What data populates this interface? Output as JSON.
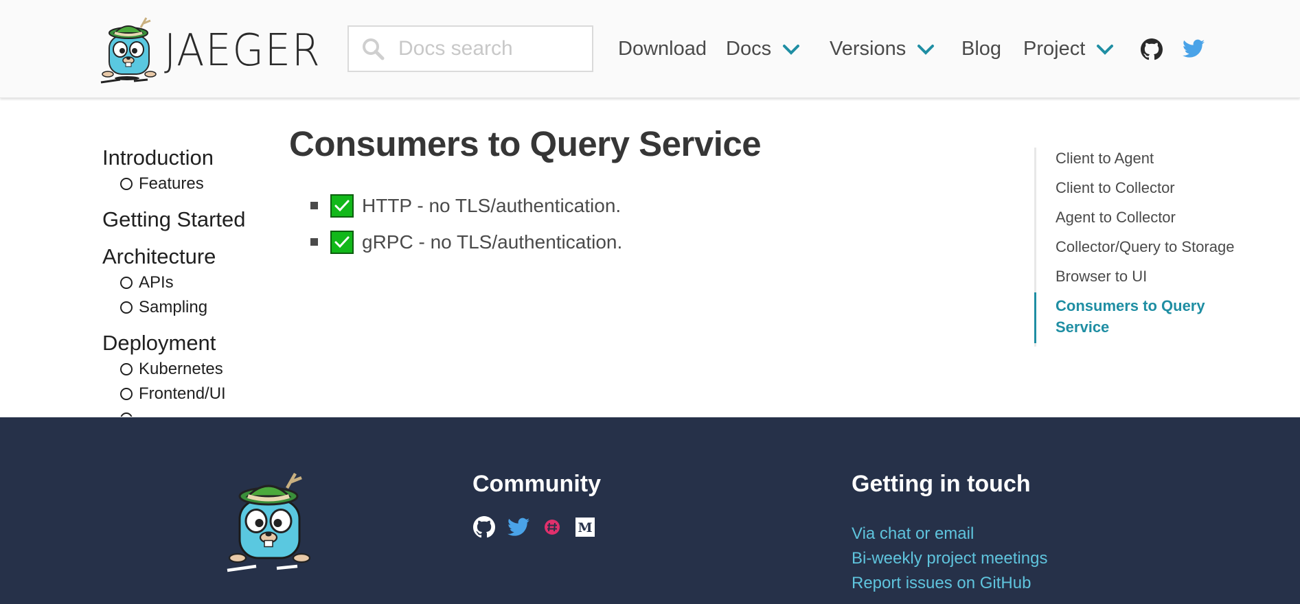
{
  "header": {
    "brand": "JAEGER",
    "search": {
      "placeholder": "Docs search"
    },
    "nav": [
      {
        "label": "Download",
        "dropdown": false
      },
      {
        "label": "Docs",
        "dropdown": true
      },
      {
        "label": "Versions",
        "dropdown": true
      },
      {
        "label": "Blog",
        "dropdown": false
      },
      {
        "label": "Project",
        "dropdown": true
      }
    ],
    "icons": [
      "github-icon",
      "twitter-icon"
    ]
  },
  "sidebar": {
    "sections": [
      {
        "title": "Introduction",
        "items": [
          "Features"
        ]
      },
      {
        "title": "Getting Started",
        "items": []
      },
      {
        "title": "Architecture",
        "items": [
          "APIs",
          "Sampling"
        ]
      },
      {
        "title": "Deployment",
        "items": [
          "Kubernetes",
          "Frontend/UI"
        ]
      }
    ]
  },
  "main": {
    "title": "Consumers to Query Service",
    "items": [
      "HTTP - no TLS/authentication.",
      "gRPC - no TLS/authentication."
    ]
  },
  "toc": {
    "items": [
      "Client to Agent",
      "Client to Collector",
      "Agent to Collector",
      "Collector/Query to Storage",
      "Browser to UI",
      "Consumers to Query Service"
    ],
    "active_index": 5
  },
  "footer": {
    "community_heading": "Community",
    "social_icons": [
      "github-icon",
      "twitter-icon",
      "slack-icon",
      "medium-icon"
    ],
    "touch_heading": "Getting in touch",
    "touch_links": [
      "Via chat or email",
      "Bi-weekly project meetings",
      "Report issues on GitHub"
    ]
  },
  "colors": {
    "accent": "#1f8ea3",
    "footer_bg": "#263149",
    "footer_link": "#5fc4dd",
    "check_green": "#12b81a",
    "twitter": "#4aa3e8"
  }
}
